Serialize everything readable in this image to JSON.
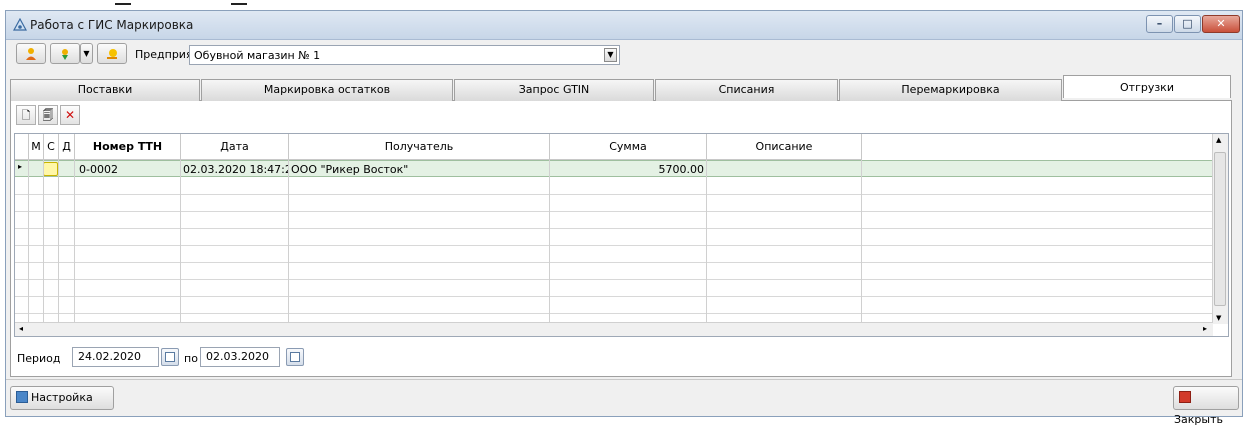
{
  "window": {
    "title": "Работа с ГИС Маркировка"
  },
  "toolbar": {
    "enterprise_label": "Предприятие",
    "enterprise_value": "Обувной магазин № 1"
  },
  "tabs": [
    {
      "label": "Поставки"
    },
    {
      "label": "Маркировка остатков"
    },
    {
      "label": "Запрос GTIN"
    },
    {
      "label": "Списания"
    },
    {
      "label": "Перемаркировка"
    },
    {
      "label": "Отгрузки",
      "active": true
    }
  ],
  "grid": {
    "columns": [
      "М",
      "С",
      "Д",
      "Номер ТТН",
      "Дата",
      "Получатель",
      "Сумма",
      "Описание"
    ],
    "rows": [
      {
        "number": "0-0002",
        "date": "02.03.2020 18:47:2",
        "recipient": "ООО \"Рикер Восток\"",
        "sum": "5700.00",
        "description": ""
      }
    ]
  },
  "period": {
    "label": "Период",
    "from": "24.02.2020",
    "to_label": "по",
    "to": "02.03.2020"
  },
  "footer": {
    "settings_label": "Настройка",
    "close_label": "Закрыть"
  }
}
